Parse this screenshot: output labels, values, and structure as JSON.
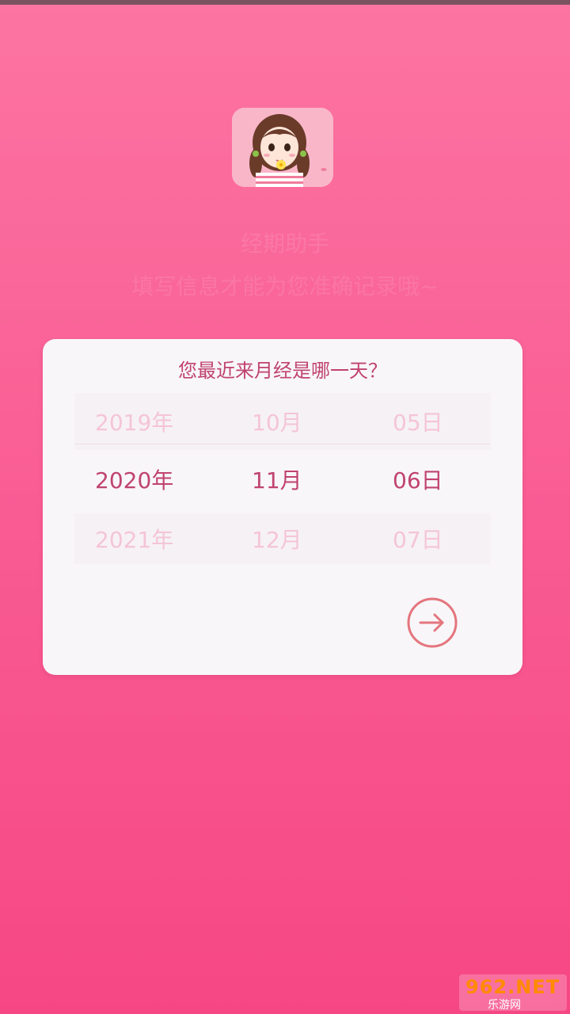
{
  "header": {
    "ghost_title": "经期助手",
    "ghost_subtitle": "填写信息才能为您准确记录哦~"
  },
  "card": {
    "question": "您最近来月经是哪一天？",
    "picker": {
      "rows": [
        {
          "year": "2019年",
          "month": "10月",
          "day": "05日"
        },
        {
          "year": "2020年",
          "month": "11月",
          "day": "06日"
        },
        {
          "year": "2021年",
          "month": "12月",
          "day": "07日"
        }
      ],
      "selected_index": 1
    },
    "next_icon": "arrow-right-circle-icon"
  },
  "watermark": {
    "top": "962.NET",
    "bottom": "乐游网"
  },
  "colors": {
    "accent": "#c0436f",
    "arrow": "#e4757e",
    "faded": "#f4c5d5",
    "background_top": "#fc74a2",
    "background_bottom": "#f64784"
  }
}
